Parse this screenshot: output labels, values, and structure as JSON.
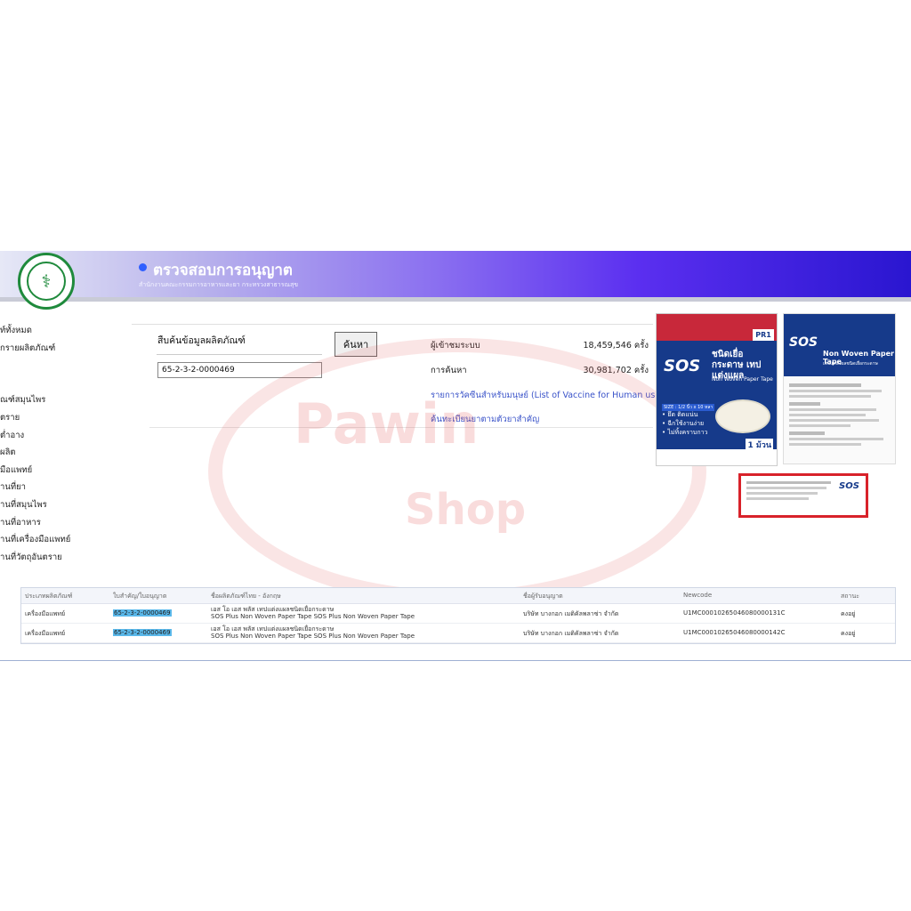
{
  "header": {
    "title": "ตรวจสอบการอนุญาต",
    "subtitle": "สำนักงานคณะกรรมการอาหารและยา กระทรวงสาธารณสุข",
    "logo_icon": "ministry-of-public-health-emblem"
  },
  "sidebar": {
    "items": [
      "ท์ทั้งหมด",
      "กรายผลิตภัณฑ์",
      "",
      "",
      "ณฑ์สมุนไพร",
      "ตราย",
      "ต่ำอาง",
      "ผลิต",
      "มือแพทย์",
      "านที่ยา",
      "านที่สมุนไพร",
      "านที่อาหาร",
      "านที่เครื่องมือแพทย์",
      "านที่วัตถุอันตราย"
    ]
  },
  "search": {
    "label": "สืบค้นข้อมูลผลิตภัณฑ์",
    "value": "65-2-3-2-0000469",
    "button_label": "ค้นหา"
  },
  "stats": {
    "visitors_label": "ผู้เข้าชมระบบ",
    "visitors_value": "18,459,546 ครั้ง",
    "searches_label": "การค้นหา",
    "searches_value": "30,981,702 ครั้ง"
  },
  "links": {
    "vaccine": "รายการวัคซีนสำหรับมนุษย์ (List of Vaccine for Human use)",
    "drug_registry": "ค้นทะเบียนยาตามตัวยาสำคัญ"
  },
  "watermark": {
    "line1": "Pawin",
    "line2": "Shop"
  },
  "product_box": {
    "brand": "SOS",
    "th_name": "ชนิดเยื่อกระดาษ เทปแต่งแผล",
    "en_name": "Non Woven Paper Tape",
    "code": "PR1",
    "size": "SIZE : 1/2 นิ้ว x 10 หลา",
    "features": "• ยึด ติดแน่น\n• ฉีกใช้งานง่าย\n• ไม่ทิ้งคราบกาว",
    "count": "1 ม้วน",
    "back_en_name": "Non Woven Paper Tape",
    "back_th_name": "เทปแต่งแผลชนิดเยื่อกระดาษ"
  },
  "table": {
    "headers": [
      "ประเภทผลิตภัณฑ์",
      "ใบสำคัญ/ใบอนุญาต",
      "ชื่อผลิตภัณฑ์ไทย - อังกฤษ",
      "ชื่อผู้รับอนุญาต",
      "Newcode",
      "สถานะ"
    ],
    "rows": [
      {
        "type": "เครื่องมือแพทย์",
        "license": "65-2-3-2-0000469",
        "name_th": "เอส โอ เอส พลัส เทปแต่งแผลชนิดเยื่อกระดาษ",
        "name_en": "SOS Plus Non Woven Paper Tape SOS Plus Non Woven Paper Tape",
        "licensee": "บริษัท บางกอก เมดิคัลพลาซ่า จำกัด",
        "newcode": "U1MC00010265046080000131C",
        "status": "คงอยู่"
      },
      {
        "type": "เครื่องมือแพทย์",
        "license": "65-2-3-2-0000469",
        "name_th": "เอส โอ เอส พลัส เทปแต่งแผลชนิดเยื่อกระดาษ",
        "name_en": "SOS Plus Non Woven Paper Tape SOS Plus Non Woven Paper Tape",
        "licensee": "บริษัท บางกอก เมดิคัลพลาซ่า จำกัด",
        "newcode": "U1MC00010265046080000142C",
        "status": "คงอยู่"
      }
    ]
  }
}
